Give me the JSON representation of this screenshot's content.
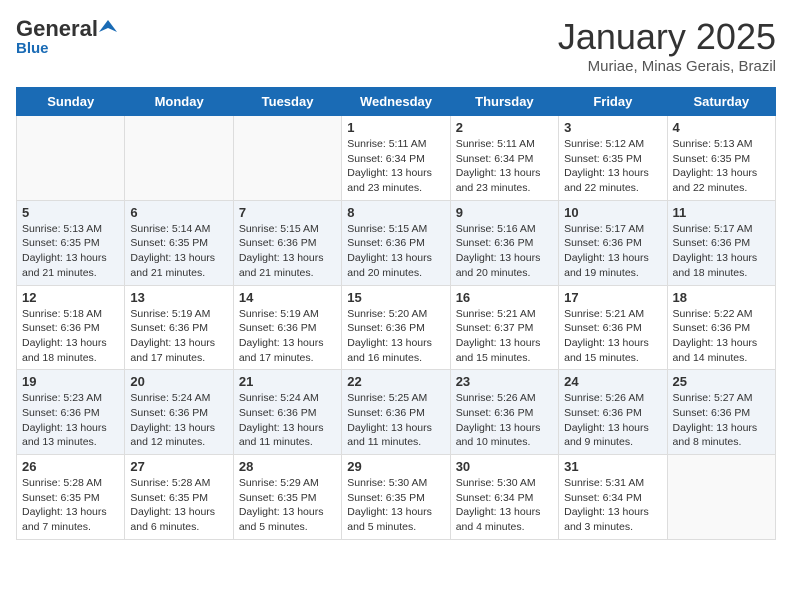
{
  "header": {
    "logo_general": "General",
    "logo_blue": "Blue",
    "title": "January 2025",
    "subtitle": "Muriae, Minas Gerais, Brazil"
  },
  "days_of_week": [
    "Sunday",
    "Monday",
    "Tuesday",
    "Wednesday",
    "Thursday",
    "Friday",
    "Saturday"
  ],
  "weeks": [
    [
      {
        "day": "",
        "info": ""
      },
      {
        "day": "",
        "info": ""
      },
      {
        "day": "",
        "info": ""
      },
      {
        "day": "1",
        "info": "Sunrise: 5:11 AM\nSunset: 6:34 PM\nDaylight: 13 hours and 23 minutes."
      },
      {
        "day": "2",
        "info": "Sunrise: 5:11 AM\nSunset: 6:34 PM\nDaylight: 13 hours and 23 minutes."
      },
      {
        "day": "3",
        "info": "Sunrise: 5:12 AM\nSunset: 6:35 PM\nDaylight: 13 hours and 22 minutes."
      },
      {
        "day": "4",
        "info": "Sunrise: 5:13 AM\nSunset: 6:35 PM\nDaylight: 13 hours and 22 minutes."
      }
    ],
    [
      {
        "day": "5",
        "info": "Sunrise: 5:13 AM\nSunset: 6:35 PM\nDaylight: 13 hours and 21 minutes."
      },
      {
        "day": "6",
        "info": "Sunrise: 5:14 AM\nSunset: 6:35 PM\nDaylight: 13 hours and 21 minutes."
      },
      {
        "day": "7",
        "info": "Sunrise: 5:15 AM\nSunset: 6:36 PM\nDaylight: 13 hours and 21 minutes."
      },
      {
        "day": "8",
        "info": "Sunrise: 5:15 AM\nSunset: 6:36 PM\nDaylight: 13 hours and 20 minutes."
      },
      {
        "day": "9",
        "info": "Sunrise: 5:16 AM\nSunset: 6:36 PM\nDaylight: 13 hours and 20 minutes."
      },
      {
        "day": "10",
        "info": "Sunrise: 5:17 AM\nSunset: 6:36 PM\nDaylight: 13 hours and 19 minutes."
      },
      {
        "day": "11",
        "info": "Sunrise: 5:17 AM\nSunset: 6:36 PM\nDaylight: 13 hours and 18 minutes."
      }
    ],
    [
      {
        "day": "12",
        "info": "Sunrise: 5:18 AM\nSunset: 6:36 PM\nDaylight: 13 hours and 18 minutes."
      },
      {
        "day": "13",
        "info": "Sunrise: 5:19 AM\nSunset: 6:36 PM\nDaylight: 13 hours and 17 minutes."
      },
      {
        "day": "14",
        "info": "Sunrise: 5:19 AM\nSunset: 6:36 PM\nDaylight: 13 hours and 17 minutes."
      },
      {
        "day": "15",
        "info": "Sunrise: 5:20 AM\nSunset: 6:36 PM\nDaylight: 13 hours and 16 minutes."
      },
      {
        "day": "16",
        "info": "Sunrise: 5:21 AM\nSunset: 6:37 PM\nDaylight: 13 hours and 15 minutes."
      },
      {
        "day": "17",
        "info": "Sunrise: 5:21 AM\nSunset: 6:36 PM\nDaylight: 13 hours and 15 minutes."
      },
      {
        "day": "18",
        "info": "Sunrise: 5:22 AM\nSunset: 6:36 PM\nDaylight: 13 hours and 14 minutes."
      }
    ],
    [
      {
        "day": "19",
        "info": "Sunrise: 5:23 AM\nSunset: 6:36 PM\nDaylight: 13 hours and 13 minutes."
      },
      {
        "day": "20",
        "info": "Sunrise: 5:24 AM\nSunset: 6:36 PM\nDaylight: 13 hours and 12 minutes."
      },
      {
        "day": "21",
        "info": "Sunrise: 5:24 AM\nSunset: 6:36 PM\nDaylight: 13 hours and 11 minutes."
      },
      {
        "day": "22",
        "info": "Sunrise: 5:25 AM\nSunset: 6:36 PM\nDaylight: 13 hours and 11 minutes."
      },
      {
        "day": "23",
        "info": "Sunrise: 5:26 AM\nSunset: 6:36 PM\nDaylight: 13 hours and 10 minutes."
      },
      {
        "day": "24",
        "info": "Sunrise: 5:26 AM\nSunset: 6:36 PM\nDaylight: 13 hours and 9 minutes."
      },
      {
        "day": "25",
        "info": "Sunrise: 5:27 AM\nSunset: 6:36 PM\nDaylight: 13 hours and 8 minutes."
      }
    ],
    [
      {
        "day": "26",
        "info": "Sunrise: 5:28 AM\nSunset: 6:35 PM\nDaylight: 13 hours and 7 minutes."
      },
      {
        "day": "27",
        "info": "Sunrise: 5:28 AM\nSunset: 6:35 PM\nDaylight: 13 hours and 6 minutes."
      },
      {
        "day": "28",
        "info": "Sunrise: 5:29 AM\nSunset: 6:35 PM\nDaylight: 13 hours and 5 minutes."
      },
      {
        "day": "29",
        "info": "Sunrise: 5:30 AM\nSunset: 6:35 PM\nDaylight: 13 hours and 5 minutes."
      },
      {
        "day": "30",
        "info": "Sunrise: 5:30 AM\nSunset: 6:34 PM\nDaylight: 13 hours and 4 minutes."
      },
      {
        "day": "31",
        "info": "Sunrise: 5:31 AM\nSunset: 6:34 PM\nDaylight: 13 hours and 3 minutes."
      },
      {
        "day": "",
        "info": ""
      }
    ]
  ]
}
